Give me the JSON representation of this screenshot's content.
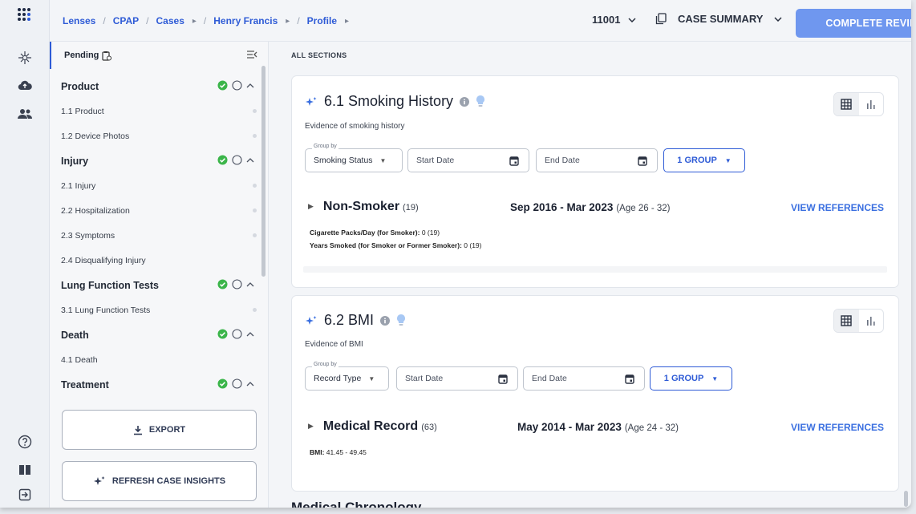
{
  "rail": {
    "icons": [
      "logo-icon",
      "sparkle-nav-icon",
      "cloud-upload-icon",
      "users-icon",
      "help-icon",
      "book-icon",
      "logout-icon"
    ]
  },
  "breadcrumb": {
    "items": [
      "Lenses",
      "CPAP",
      "Cases",
      "Henry Francis",
      "Profile"
    ]
  },
  "header": {
    "case_id": "11001",
    "case_summary": "CASE SUMMARY",
    "complete_review": "COMPLETE REVIEW"
  },
  "sidebar": {
    "status": "Pending",
    "sections": [
      {
        "label": "Product",
        "items": [
          "1.1  Product",
          "1.2  Device Photos"
        ]
      },
      {
        "label": "Injury",
        "items": [
          "2.1  Injury",
          "2.2  Hospitalization",
          "2.3  Symptoms",
          "2.4  Disqualifying Injury"
        ]
      },
      {
        "label": "Lung Function Tests",
        "items": [
          "3.1  Lung Function Tests"
        ]
      },
      {
        "label": "Death",
        "items": [
          "4.1  Death"
        ]
      },
      {
        "label": "Treatment",
        "items": []
      }
    ],
    "export_label": "EXPORT",
    "refresh_label": "REFRESH CASE INSIGHTS"
  },
  "main": {
    "all_sections": "ALL SECTIONS",
    "cards": [
      {
        "title": "6.1 Smoking History",
        "subtitle": "Evidence of smoking history",
        "group_by_legend": "Group by",
        "group_by": "Smoking Status",
        "start_date": "Start Date",
        "end_date": "End Date",
        "group_button": "1 GROUP",
        "row": {
          "name": "Non-Smoker",
          "count": "(19)",
          "date_range": "Sep 2016 - Mar 2023",
          "age": "(Age 26 - 32)",
          "view_refs": "VIEW REFERENCES",
          "fields": [
            {
              "key": "Cigarette Packs/Day (for Smoker):",
              "value": "0 (19)"
            },
            {
              "key": "Years Smoked (for Smoker or Former Smoker):",
              "value": "0 (19)"
            }
          ]
        }
      },
      {
        "title": "6.2 BMI",
        "subtitle": "Evidence of BMI",
        "group_by_legend": "Group by",
        "group_by": "Record Type",
        "start_date": "Start Date",
        "end_date": "End Date",
        "group_button": "1 GROUP",
        "row": {
          "name": "Medical Record",
          "count": "(63)",
          "date_range": "May 2014 - Mar 2023",
          "age": "(Age 24 - 32)",
          "view_refs": "VIEW REFERENCES",
          "fields": [
            {
              "key": "BMI:",
              "value": "41.45 - 49.45"
            }
          ]
        }
      }
    ],
    "next_heading": "Medical Chronology"
  },
  "colors": {
    "accent": "#2e5bd6",
    "complete_button": "#6f97ef",
    "check_green": "#3bb54a"
  }
}
